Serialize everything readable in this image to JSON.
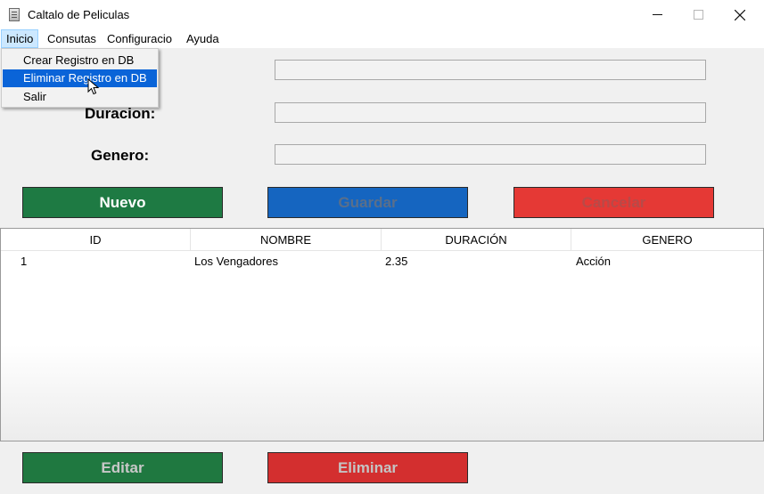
{
  "window": {
    "title": "Caltalo de Peliculas"
  },
  "menu": [
    "Inicio",
    "Consutas",
    "Configuracio",
    "Ayuda"
  ],
  "dropdown": [
    "Crear Registro en DB",
    "Eliminar Registro en DB",
    "Salir"
  ],
  "form": {
    "duracion_label": "Duracion:",
    "genero_label": "Genero:"
  },
  "buttons": {
    "nuevo": "Nuevo",
    "guardar": "Guardar",
    "cancelar": "Cancelar",
    "editar": "Editar",
    "eliminar": "Eliminar"
  },
  "table": {
    "columns": [
      "ID",
      "NOMBRE",
      "DURACIÓN",
      "GENERO"
    ],
    "rows": [
      [
        "1",
        "Los Vengadores",
        "2.35",
        "Acción"
      ]
    ]
  },
  "colors": {
    "green": "#1e7a43",
    "blue": "#1565c0",
    "red": "#e53935",
    "highlight": "#0a64d8"
  },
  "icons": {
    "app": "notebook-icon",
    "minimize": "minimize-icon",
    "maximize": "maximize-icon",
    "close": "close-icon",
    "cursor": "mouse-cursor-icon"
  }
}
